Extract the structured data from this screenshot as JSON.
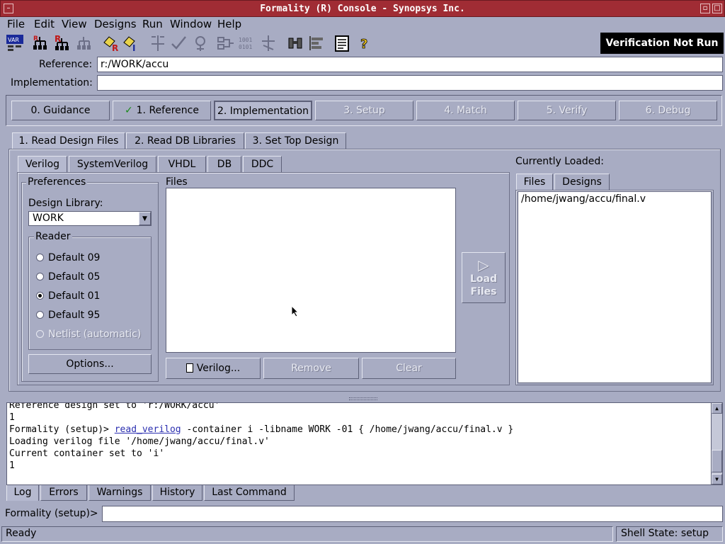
{
  "window": {
    "title": "Formality (R) Console - Synopsys Inc."
  },
  "menu": [
    "File",
    "Edit",
    "View",
    "Designs",
    "Run",
    "Window",
    "Help"
  ],
  "verification_status": "Verification Not Run",
  "reference": {
    "label": "Reference:",
    "value": "r:/WORK/accu"
  },
  "implementation": {
    "label": "Implementation:",
    "value": ""
  },
  "flow": [
    {
      "label": "0. Guidance",
      "state": "enabled"
    },
    {
      "label": "1. Reference",
      "state": "done"
    },
    {
      "label": "2. Implementation",
      "state": "active"
    },
    {
      "label": "3. Setup",
      "state": "disabled"
    },
    {
      "label": "4. Match",
      "state": "disabled"
    },
    {
      "label": "5. Verify",
      "state": "disabled"
    },
    {
      "label": "6. Debug",
      "state": "disabled"
    }
  ],
  "subtabs": [
    "1. Read Design Files",
    "2. Read DB Libraries",
    "3. Set Top Design"
  ],
  "format_tabs": [
    "Verilog",
    "SystemVerilog",
    "VHDL",
    "DB",
    "DDC"
  ],
  "preferences": {
    "title": "Preferences",
    "design_library_label": "Design Library:",
    "design_library_value": "WORK",
    "reader_title": "Reader",
    "reader_options": [
      "Default 09",
      "Default 05",
      "Default 01",
      "Default 95",
      "Netlist (automatic)"
    ],
    "options_button": "Options..."
  },
  "files": {
    "title": "Files",
    "buttons": {
      "verilog": "Verilog...",
      "remove": "Remove",
      "clear": "Clear"
    }
  },
  "load_files": {
    "line1": "Load",
    "line2": "Files"
  },
  "currently_loaded": {
    "title": "Currently Loaded:",
    "tabs": [
      "Files",
      "Designs"
    ],
    "items": [
      "/home/jwang/accu/final.v"
    ]
  },
  "log": {
    "lines": [
      "Reference design set to 'r:/WORK/accu'",
      "1",
      {
        "prompt": "Formality (setup)> ",
        "command": "read_verilog",
        "args": " -container i -libname WORK -01 { /home/jwang/accu/final.v }"
      },
      "Loading verilog file '/home/jwang/accu/final.v'",
      "Current container set to 'i'",
      "1"
    ]
  },
  "bottom_tabs": [
    "Log",
    "Errors",
    "Warnings",
    "History",
    "Last Command"
  ],
  "prompt": {
    "label": "Formality (setup)>",
    "value": ""
  },
  "status": {
    "left": "Ready",
    "right": "Shell State: setup"
  }
}
